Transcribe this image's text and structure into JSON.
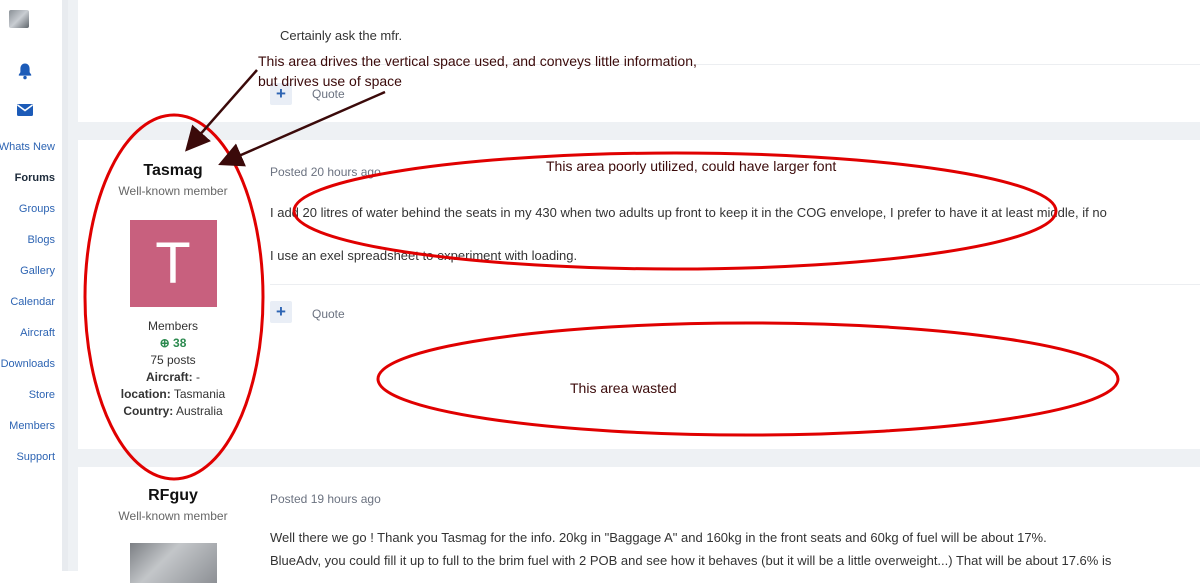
{
  "sidebar": {
    "items": [
      {
        "label": "Whats New",
        "active": false
      },
      {
        "label": "Forums",
        "active": true
      },
      {
        "label": "Groups",
        "active": false
      },
      {
        "label": "Blogs",
        "active": false
      },
      {
        "label": "Gallery",
        "active": false
      },
      {
        "label": "Calendar",
        "active": false
      },
      {
        "label": "Aircraft",
        "active": false
      },
      {
        "label": "Downloads",
        "active": false
      },
      {
        "label": "Store",
        "active": false
      },
      {
        "label": "Members",
        "active": false
      },
      {
        "label": "Support",
        "active": false
      }
    ],
    "icons": [
      "bell-icon",
      "envelope-icon"
    ],
    "accent_color": "#1c5bb8"
  },
  "posts": [
    {
      "body": [
        "Certainly ask the mfr."
      ],
      "quote_label": "Quote"
    },
    {
      "author": "Tasmag",
      "author_title": "Well-known member",
      "avatar_letter": "T",
      "avatar_color": "#c8607e",
      "group": "Members",
      "reputation": "38",
      "posts_count": "75 posts",
      "aircraft_label": "Aircraft:",
      "aircraft_value": "-",
      "location_label": "location:",
      "location_value": "Tasmania",
      "country_label": "Country:",
      "country_value": "Australia",
      "posted": "Posted 20 hours ago",
      "body": [
        "I add 20 litres of water behind the seats in my 430 when two adults up front to keep it in the COG envelope, I prefer to have it at least middle, if no",
        "I use an exel spreadsheet to experiment with loading."
      ],
      "quote_label": "Quote"
    },
    {
      "author": "RFguy",
      "author_title": "Well-known member",
      "posted": "Posted 19 hours ago",
      "body": [
        "Well there we go ! Thank you Tasmag for the info. 20kg in \"Baggage A\" and 160kg in the front seats and 60kg of fuel will be about 17%.",
        "BlueAdv, you could fill it up to full to the brim fuel with 2 POB and see how it behaves (but it will be a little overweight...) That will be about 17.6% is"
      ]
    }
  ],
  "annotations": {
    "color": "#e00000",
    "arrow_color": "#3b0a0a",
    "note_top_line1": "This area drives the vertical space used, and conveys little information,",
    "note_top_line2": "but drives use of space",
    "note_middle": "This area poorly utilized, could have larger font",
    "note_bottom": "This area wasted"
  }
}
